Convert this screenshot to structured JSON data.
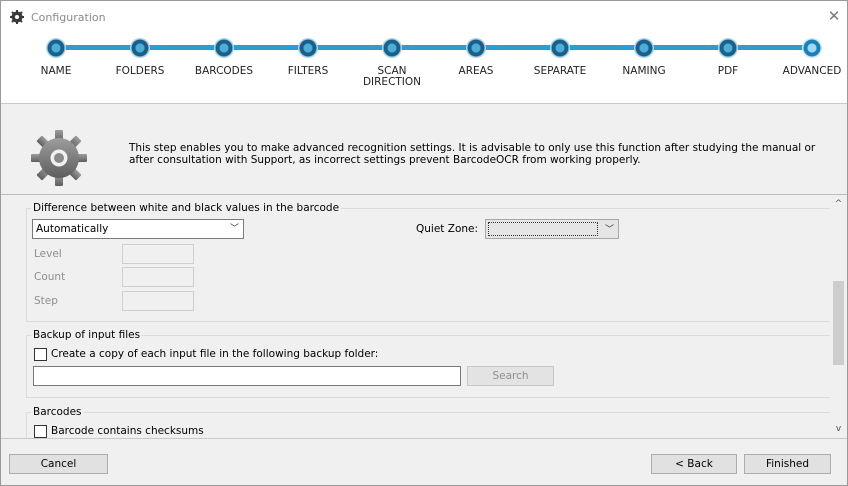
{
  "window": {
    "title": "Configuration",
    "close_glyph": "✕"
  },
  "wizard": {
    "steps": [
      {
        "label": "NAME",
        "active": false
      },
      {
        "label": "FOLDERS",
        "active": false
      },
      {
        "label": "BARCODES",
        "active": false
      },
      {
        "label": "FILTERS",
        "active": false
      },
      {
        "label": "SCAN DIRECTION",
        "active": false
      },
      {
        "label": "AREAS",
        "active": false
      },
      {
        "label": "SEPARATE",
        "active": false
      },
      {
        "label": "NAMING",
        "active": false
      },
      {
        "label": "PDF",
        "active": false
      },
      {
        "label": "ADVANCED",
        "active": true
      }
    ],
    "accent_color": "#2e9bd2"
  },
  "info": {
    "icon": "gear-icon",
    "text": "This step enables you to make advanced recognition settings. It is advisable to only use this function after studying the manual or after consultation with Support, as incorrect settings prevent BarcodeOCR from working properly."
  },
  "difference": {
    "title": "Difference between white and black values in the barcode",
    "mode": "Automatically",
    "quiet_zone_label": "Quiet Zone:",
    "quiet_zone_value": "",
    "level_label": "Level",
    "count_label": "Count",
    "step_label": "Step"
  },
  "backup": {
    "title": "Backup of input files",
    "checkbox_label": "Create a copy of each input file in the following backup folder:",
    "checked": false,
    "folder_value": "",
    "search_label": "Search"
  },
  "barcodes": {
    "title": "Barcodes",
    "checksum_label": "Barcode contains checksums",
    "checked": false
  },
  "footer": {
    "cancel_label": "Cancel",
    "back_label": "< Back",
    "finished_label": "Finished"
  }
}
